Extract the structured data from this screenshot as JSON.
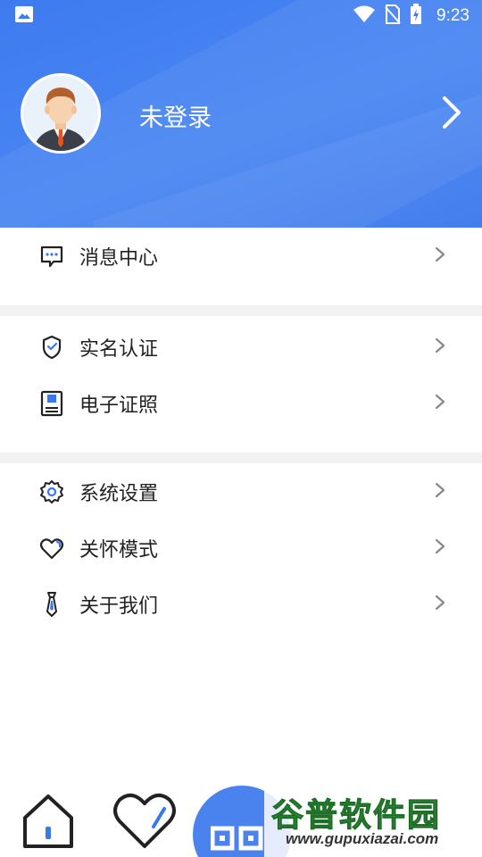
{
  "status_bar": {
    "time": "9:23",
    "icons": [
      "image-icon",
      "wifi-icon",
      "no-sim-icon",
      "battery-charging-icon"
    ]
  },
  "profile": {
    "login_text": "未登录",
    "avatar_icon": "user-avatar"
  },
  "menu": {
    "group1": [
      {
        "label": "消息中心",
        "icon": "message-icon"
      }
    ],
    "group2": [
      {
        "label": "实名认证",
        "icon": "shield-check-icon"
      },
      {
        "label": "电子证照",
        "icon": "document-card-icon"
      }
    ],
    "group3": [
      {
        "label": "系统设置",
        "icon": "gear-icon"
      },
      {
        "label": "关怀模式",
        "icon": "heart-icon"
      },
      {
        "label": "关于我们",
        "icon": "tie-icon"
      }
    ]
  },
  "tab_bar": {
    "icons": [
      "home-icon",
      "heart-tab-icon",
      "qr-scan-icon"
    ]
  },
  "watermark": {
    "title": "谷普软件园",
    "url": "www.gupuxiazai.com"
  },
  "colors": {
    "header_blue": "#3d7bf0",
    "icon_blue": "#3a78ee",
    "watermark_green": "#2f9e3a"
  }
}
